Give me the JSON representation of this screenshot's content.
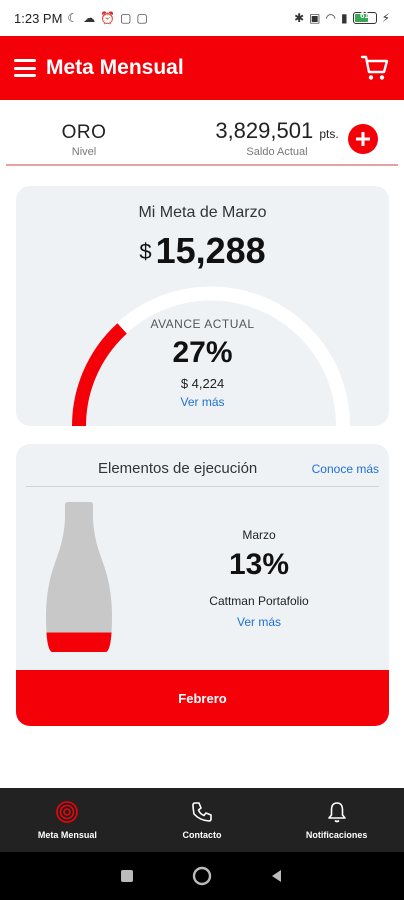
{
  "status_bar": {
    "time": "1:23 PM",
    "battery_level": "61"
  },
  "app_bar": {
    "title": "Meta Mensual"
  },
  "summary": {
    "level_value": "ORO",
    "level_label": "Nivel",
    "balance_value": "3,829,501",
    "balance_unit": "pts.",
    "balance_label": "Saldo Actual"
  },
  "goal": {
    "title": "Mi Meta de Marzo",
    "currency": "$",
    "amount": "15,288",
    "progress_label": "AVANCE ACTUAL",
    "progress_percent": "27%",
    "progress_fraction": 0.27,
    "progress_amount": "$ 4,224",
    "see_more": "Ver más"
  },
  "execution": {
    "title": "Elementos de ejecución",
    "learn_more": "Conoce más",
    "month": "Marzo",
    "percent": "13%",
    "fill_fraction": 0.13,
    "name": "Cattman Portafolio",
    "see_more": "Ver más",
    "month_button": "Febrero"
  },
  "bottom_nav": {
    "items": [
      {
        "label": "Meta Mensual",
        "icon": "target-icon"
      },
      {
        "label": "Contacto",
        "icon": "phone-icon"
      },
      {
        "label": "Notificaciones",
        "icon": "bell-icon"
      }
    ]
  },
  "colors": {
    "brand_red": "#f40009",
    "link_blue": "#1f6fd6",
    "card_bg": "#eef2f5",
    "nav_bg": "#222222"
  }
}
